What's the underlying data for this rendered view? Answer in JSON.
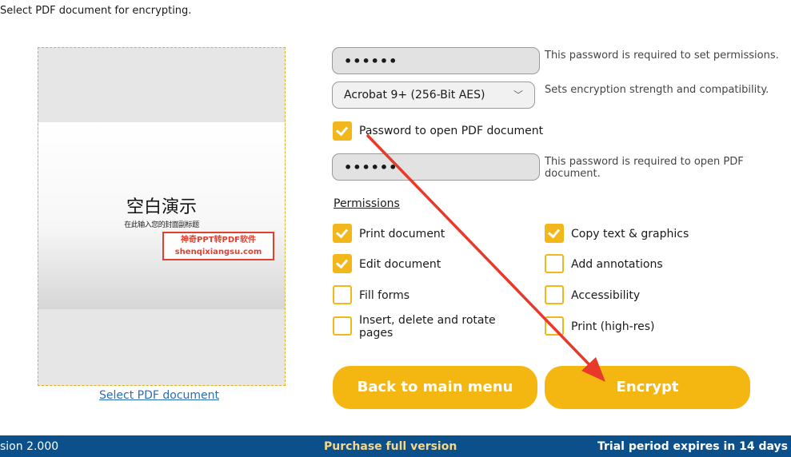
{
  "header": {
    "instruction": "Select PDF document for encrypting."
  },
  "preview": {
    "slide_title": "空白演示",
    "slide_subtitle": "在此输入您的封面副标题",
    "stamp_line1": "神奇PPT转PDF软件",
    "stamp_line2": "shenqixiangsu.com",
    "select_link": "Select PDF document"
  },
  "permissions_password": {
    "value": "••••••",
    "hint": "This password is required to set permissions."
  },
  "encryption": {
    "selected": "Acrobat 9+ (256-Bit AES)",
    "hint": "Sets encryption strength and compatibility."
  },
  "open_password_toggle": {
    "label": "Password to open PDF document",
    "checked": true
  },
  "open_password": {
    "value": "••••••",
    "hint": "This password is required to open PDF document."
  },
  "permissions": {
    "title": "Permissions",
    "items": [
      {
        "label": "Print document",
        "checked": true
      },
      {
        "label": "Copy text & graphics",
        "checked": true
      },
      {
        "label": "Edit document",
        "checked": true
      },
      {
        "label": "Add annotations",
        "checked": false
      },
      {
        "label": "Fill forms",
        "checked": false
      },
      {
        "label": "Accessibility",
        "checked": false
      },
      {
        "label": "Insert, delete and rotate pages",
        "checked": false
      },
      {
        "label": "Print (high-res)",
        "checked": false
      }
    ]
  },
  "buttons": {
    "back": "Back to main menu",
    "encrypt": "Encrypt"
  },
  "footer": {
    "version": "sion 2.000",
    "purchase": "Purchase full version",
    "trial": "Trial period expires in 14 days"
  },
  "colors": {
    "accent": "#f4b712",
    "footer_bg": "#0b4f8b",
    "link": "#2a6db5",
    "annotation_arrow": "#e8392a"
  }
}
